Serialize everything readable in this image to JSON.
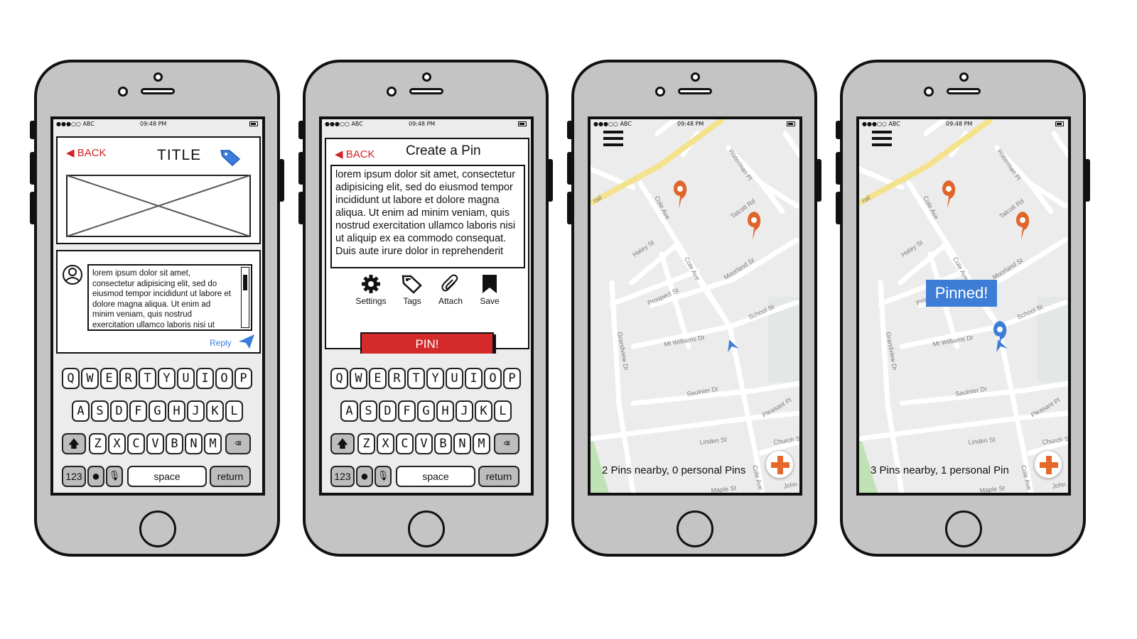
{
  "status_bar": {
    "carrier": "●●●○○ ABC",
    "time": "09:48 PM"
  },
  "keyboard": {
    "row1": [
      "Q",
      "W",
      "E",
      "R",
      "T",
      "Y",
      "U",
      "I",
      "O",
      "P"
    ],
    "row2": [
      "A",
      "S",
      "D",
      "F",
      "G",
      "H",
      "J",
      "K",
      "L"
    ],
    "row3": [
      "Z",
      "X",
      "C",
      "V",
      "B",
      "N",
      "M"
    ],
    "numbers": "123",
    "space": "space",
    "return": "return"
  },
  "screen1": {
    "back_label": "BACK",
    "title": "TITLE",
    "comment_text": "lorem ipsum dolor sit amet, consectetur adipisicing elit, sed do eiusmod tempor incididunt ut labore et dolore magna aliqua. Ut enim ad minim veniam, quis nostrud exercitation ullamco laboris nisi ut",
    "reply_label": "Reply"
  },
  "screen2": {
    "back_label": "BACK",
    "title": "Create a Pin",
    "body_text": "lorem ipsum dolor sit amet, consectetur adipisicing elit, sed do eiusmod tempor incididunt ut labore et dolore magna aliqua. Ut enim ad minim veniam, quis nostrud exercitation ullamco laboris nisi ut aliquip ex ea commodo consequat. Duis aute irure dolor in reprehenderit",
    "tools": [
      "Settings",
      "Tags",
      "Attach",
      "Save"
    ],
    "pin_button": "PIN!"
  },
  "map_labels": {
    "cole_ave": "Cole Ave",
    "haley": "Haley St",
    "prospect": "Prospect St",
    "moorland": "Moorland St",
    "school": "School St",
    "mt_williams": "Mt Williams Dr",
    "saulnier": "Saulnier Dr",
    "linden": "Linden St",
    "pleasant": "Pleasant Pl",
    "church": "Church S",
    "talcott": "Talcott Rd",
    "waterman": "Waterman Pl",
    "grandview": "Grandview Dr",
    "trail": "rail",
    "maple": "Maple St",
    "john": "John"
  },
  "screen3": {
    "status": "2 Pins nearby, 0 personal Pins"
  },
  "screen4": {
    "status": "3 Pins nearby, 1 personal Pin",
    "toast": "Pinned!"
  },
  "colors": {
    "accent_red": "#d42a2a",
    "map_pin": "#e0652b",
    "user_blue": "#3d7dd6",
    "road_yellow": "#f5e28c"
  }
}
